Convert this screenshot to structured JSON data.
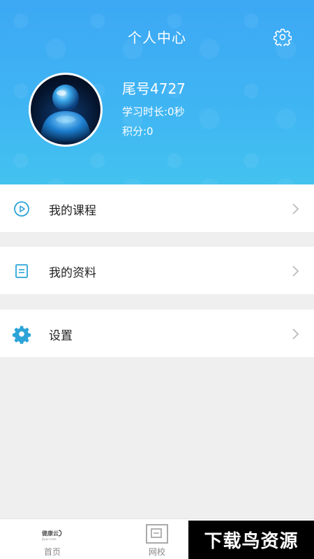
{
  "header": {
    "title": "个人中心",
    "settings_icon": "gear-icon",
    "accent_color": "#3fb4f3"
  },
  "profile": {
    "avatar_icon": "avatar-figure",
    "name": "尾号4727",
    "study_time": "学习时长:0秒",
    "points": "积分:0"
  },
  "menu": [
    {
      "label": "我的课程",
      "icon": "play-circle-icon"
    },
    {
      "label": "我的资料",
      "icon": "document-icon"
    },
    {
      "label": "设置",
      "icon": "gear-icon"
    }
  ],
  "tabbar": {
    "tabs": [
      {
        "label": "首页",
        "icon": "健康云",
        "icon_subtext": "jkyun.com"
      },
      {
        "label": "网校",
        "icon": "school-icon"
      }
    ]
  },
  "watermark": "下载鸟资源"
}
